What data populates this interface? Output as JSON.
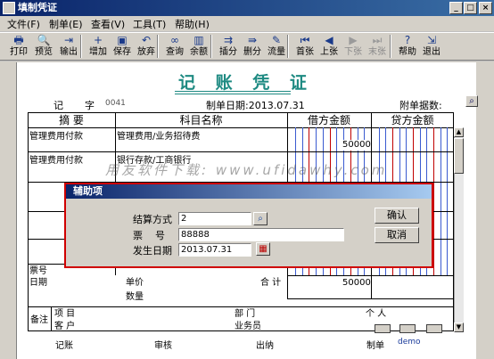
{
  "window": {
    "title": "填制凭证"
  },
  "menu": [
    "文件(F)",
    "制单(E)",
    "查看(V)",
    "工具(T)",
    "帮助(H)"
  ],
  "toolbar": [
    {
      "label": "打印",
      "icon": "printer-icon",
      "glyph": "🖶",
      "enabled": true
    },
    {
      "label": "预览",
      "icon": "preview-icon",
      "glyph": "🔍",
      "enabled": true
    },
    {
      "label": "输出",
      "icon": "export-icon",
      "glyph": "⇥",
      "enabled": true
    },
    {
      "label": "增加",
      "icon": "add-icon",
      "glyph": "+",
      "enabled": true
    },
    {
      "label": "保存",
      "icon": "save-icon",
      "glyph": "▣",
      "enabled": true
    },
    {
      "label": "放弃",
      "icon": "undo-icon",
      "glyph": "↶",
      "enabled": true
    },
    {
      "label": "查询",
      "icon": "binoculars-icon",
      "glyph": "∞",
      "enabled": true
    },
    {
      "label": "余额",
      "icon": "balance-chart-icon",
      "glyph": "▥",
      "enabled": true
    },
    {
      "label": "插分",
      "icon": "insert-row-icon",
      "glyph": "⇉",
      "enabled": true
    },
    {
      "label": "删分",
      "icon": "delete-row-icon",
      "glyph": "⇛",
      "enabled": true
    },
    {
      "label": "流量",
      "icon": "cashflow-icon",
      "glyph": "✎",
      "enabled": true
    },
    {
      "label": "首张",
      "icon": "first-icon",
      "glyph": "⏮",
      "enabled": true
    },
    {
      "label": "上张",
      "icon": "prev-icon",
      "glyph": "◀",
      "enabled": true
    },
    {
      "label": "下张",
      "icon": "next-icon",
      "glyph": "▶",
      "enabled": false
    },
    {
      "label": "末张",
      "icon": "last-icon",
      "glyph": "⏭",
      "enabled": false
    },
    {
      "label": "帮助",
      "icon": "help-icon",
      "glyph": "?",
      "enabled": true
    },
    {
      "label": "退出",
      "icon": "exit-icon",
      "glyph": "⇲",
      "enabled": true
    }
  ],
  "voucher": {
    "title": "记 账 凭 证",
    "type_label": "记",
    "type_suffix": "字",
    "number": "0041",
    "date_label": "制单日期:2013.07.31",
    "attach_label": "附单据数:",
    "columns": [
      "摘 要",
      "科目名称",
      "借方金额",
      "贷方金额"
    ],
    "rows": [
      {
        "summary": "管理费用付款",
        "account": "管理费用/业务招待费",
        "debit": "50000",
        "credit": ""
      },
      {
        "summary": "管理费用付款",
        "account": "银行存款/工商银行",
        "debit": "",
        "credit": ""
      }
    ],
    "bottom": {
      "ticket_label": "票号",
      "date_label": "日期",
      "price_label": "单价",
      "qty_label": "数量",
      "total_label": "合 计",
      "total_debit": "50000",
      "remark_label": "备注",
      "project_label": "项 目",
      "client_label": "客 户",
      "dept_label": "部 门",
      "person_label": "个 人",
      "salesman_label": "业务员"
    },
    "footer": {
      "bookkeeper": "记账",
      "auditor": "审核",
      "cashier": "出纳",
      "maker_label": "制单",
      "maker": "demo"
    }
  },
  "watermark": "用友软件下载: www.ufidawhy.com",
  "dialog": {
    "title": "辅助项",
    "fields": [
      {
        "label": "结算方式",
        "value": "2"
      },
      {
        "label": "票    号",
        "value": "88888"
      },
      {
        "label": "发生日期",
        "value": "2013.07.31"
      }
    ],
    "ok": "确认",
    "cancel": "取消"
  }
}
